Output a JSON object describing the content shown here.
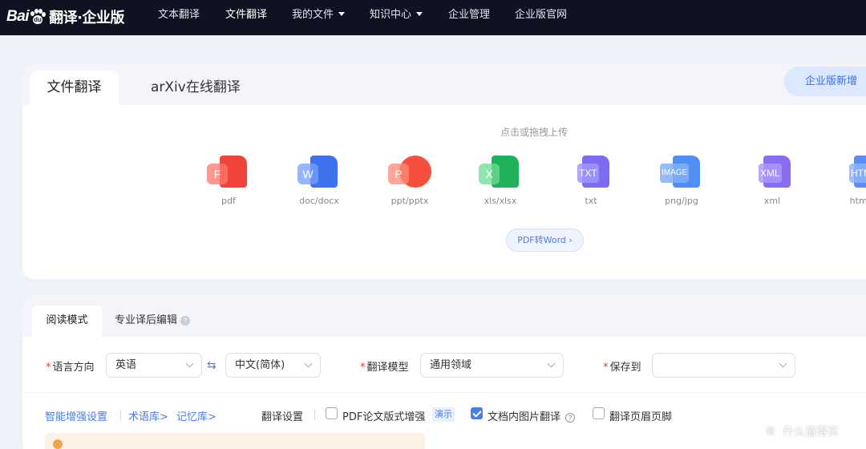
{
  "nav": {
    "logo_bai": "Bai",
    "logo_du": "du",
    "logo_text": "翻译·企业版",
    "items": [
      {
        "label": "文本翻译"
      },
      {
        "label": "文件翻译"
      },
      {
        "label": "我的文件"
      },
      {
        "label": "知识中心"
      },
      {
        "label": "企业管理"
      },
      {
        "label": "企业版官网"
      }
    ]
  },
  "upload": {
    "tabs": [
      {
        "label": "文件翻译"
      },
      {
        "label": "arXiv在线翻译"
      }
    ],
    "promo_button": "企业版新增",
    "hint": "点击或拖拽上传",
    "file_types": [
      {
        "label": "pdf",
        "badge": "F",
        "color": "#f0433a"
      },
      {
        "label": "doc/docx",
        "badge": "W",
        "color": "#3e73f0"
      },
      {
        "label": "ppt/pptx",
        "badge": "P",
        "color": "#f54f3d"
      },
      {
        "label": "xls/xlsx",
        "badge": "X",
        "color": "#20b25a"
      },
      {
        "label": "txt",
        "badge": "TXT",
        "color": "#7b6cf2"
      },
      {
        "label": "png/jpg",
        "badge": "IMAGE",
        "color": "#4f8ef2"
      },
      {
        "label": "xml",
        "badge": "XML",
        "color": "#8a6cf0"
      },
      {
        "label": "htm/h",
        "badge": "HTML",
        "color": "#5a8ef5"
      }
    ],
    "pdf_to_word": "PDF转Word"
  },
  "settings": {
    "tabs": [
      {
        "label": "阅读模式"
      },
      {
        "label": "专业译后编辑"
      }
    ],
    "required_mark": "*",
    "language_direction_label": "语言方向",
    "source_language": "英语",
    "swap_glyph": "⇆",
    "target_language": "中文(简体)",
    "model_label": "翻译模型",
    "model_value": "通用领域",
    "save_to_label": "保存到",
    "save_to_value": "",
    "links": {
      "smart": "智能增强设置",
      "term": "术语库",
      "memory": "记忆库",
      "arrow": ">"
    },
    "translate_settings_label": "翻译设置",
    "options": [
      {
        "label": "PDF论文版式增强",
        "checked": false,
        "tag": "演示"
      },
      {
        "label": "文档内图片翻译",
        "checked": true
      },
      {
        "label": "翻译页眉页脚",
        "checked": false
      }
    ]
  },
  "watermark": {
    "text": "什么值得买"
  }
}
